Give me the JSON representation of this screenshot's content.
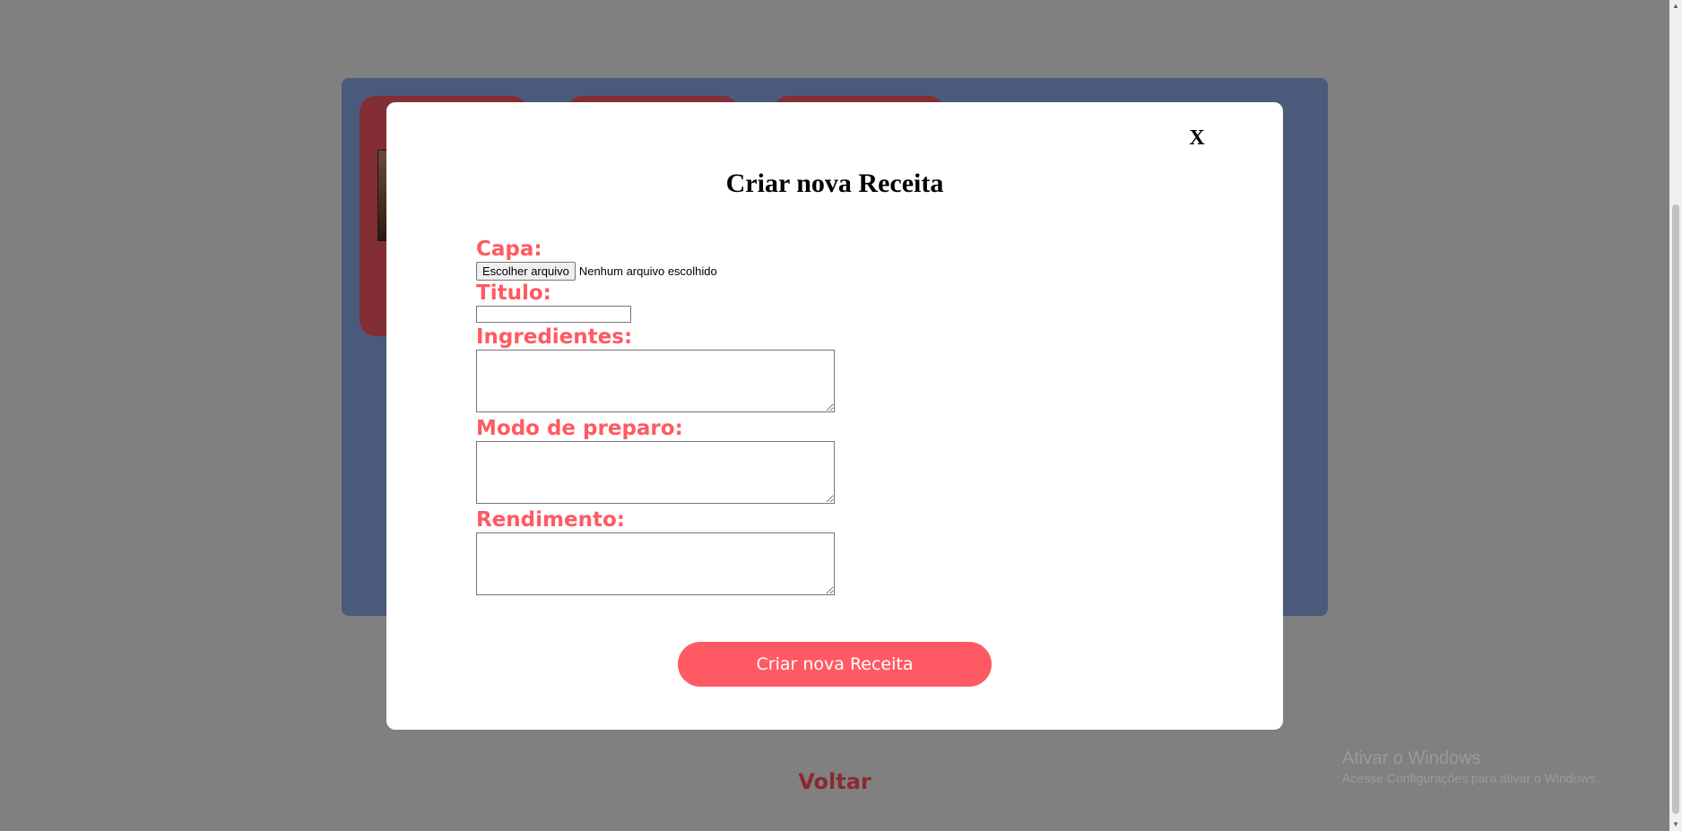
{
  "background": {
    "back_link": "Voltar"
  },
  "modal": {
    "close_label": "X",
    "title": "Criar nova Receita",
    "fields": {
      "capa_label": "Capa:",
      "file_button_label": "Escolher arquivo",
      "file_status": "Nenhum arquivo escolhido",
      "titulo_label": "Titulo:",
      "titulo_value": "",
      "ingredientes_label": "Ingredientes:",
      "ingredientes_value": "",
      "modo_preparo_label": "Modo de preparo:",
      "modo_preparo_value": "",
      "rendimento_label": "Rendimento:",
      "rendimento_value": ""
    },
    "submit_label": "Criar nova Receita"
  },
  "watermark": {
    "title": "Ativar o Windows",
    "subtitle": "Acesse Configurações para ativar o Windows."
  },
  "colors": {
    "overlay": "#808080",
    "panel": "#4b5a7b",
    "card": "#822e34",
    "accent": "#ff5a63",
    "back_link": "#8a2a30"
  },
  "icons": {
    "close": "close-icon",
    "scroll_up": "scroll-up-arrow-icon",
    "scroll_down": "scroll-down-arrow-icon"
  }
}
